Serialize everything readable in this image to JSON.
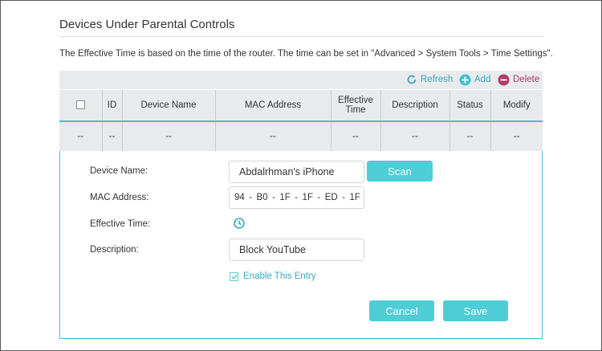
{
  "page": {
    "title": "Devices Under Parental Controls",
    "notice": "The Effective Time is based on the time of the router. The time can be set in \"Advanced > System Tools > Time Settings\"."
  },
  "toolbar": {
    "refresh_label": "Refresh",
    "add_label": "Add",
    "delete_label": "Delete",
    "refresh_icon": "refresh-icon",
    "add_icon": "add-icon",
    "delete_icon": "delete-icon"
  },
  "table": {
    "headers": [
      "",
      "ID",
      "Device Name",
      "MAC Address",
      "Effective Time",
      "Description",
      "Status",
      "Modify"
    ],
    "rows": [
      [
        "--",
        "--",
        "--",
        "--",
        "--",
        "--",
        "--",
        "--"
      ]
    ]
  },
  "form": {
    "device_name_label": "Device Name:",
    "device_name_value": "Abdalrhman's iPhone",
    "scan_label": "Scan",
    "mac_label": "MAC Address:",
    "mac_octets": [
      "94",
      "B0",
      "1F",
      "1F",
      "ED",
      "1F"
    ],
    "mac_separator": "-",
    "effective_time_label": "Effective Time:",
    "effective_time_icon": "clock-icon",
    "description_label": "Description:",
    "description_value": "Block YouTube",
    "enable_label": "Enable This Entry",
    "enable_checked": true,
    "cancel_label": "Cancel",
    "save_label": "Save"
  },
  "colors": {
    "accent": "#4ecdd6",
    "link": "#3aa8c0",
    "delete": "#b23a62",
    "header_bg": "#e8eaeb"
  }
}
